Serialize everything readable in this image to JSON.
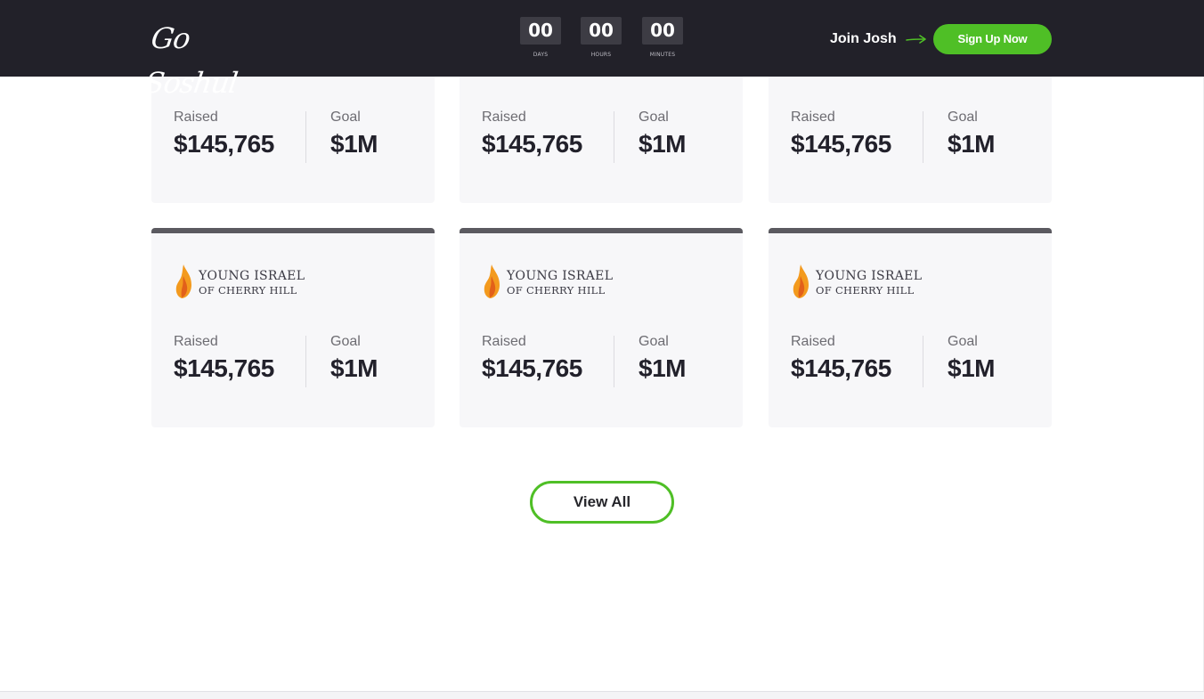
{
  "header": {
    "logo_text": "Go Soshul",
    "countdown": [
      {
        "value": "00",
        "label": "DAYS"
      },
      {
        "value": "00",
        "label": "HOURS"
      },
      {
        "value": "00",
        "label": "MINUTES"
      }
    ],
    "join_text": "Join Josh",
    "signup_label": "Sign Up Now"
  },
  "colors": {
    "header_bg": "#222129",
    "accent_green": "#4fbf26",
    "card_bg": "#f7f7f9",
    "card_bar": "#5b5a60"
  },
  "cards": [
    {
      "org_line1": "",
      "org_line2": "",
      "raised_label": "Raised",
      "raised_value": "$145,765",
      "goal_label": "Goal",
      "goal_value": "$1M"
    },
    {
      "org_line1": "",
      "org_line2": "",
      "raised_label": "Raised",
      "raised_value": "$145,765",
      "goal_label": "Goal",
      "goal_value": "$1M"
    },
    {
      "org_line1": "",
      "org_line2": "",
      "raised_label": "Raised",
      "raised_value": "$145,765",
      "goal_label": "Goal",
      "goal_value": "$1M"
    },
    {
      "org_line1": "YOUNG ISRAEL",
      "org_line2": "OF CHERRY HILL",
      "logo_icon": "flame-icon",
      "raised_label": "Raised",
      "raised_value": "$145,765",
      "goal_label": "Goal",
      "goal_value": "$1M"
    },
    {
      "org_line1": "YOUNG ISRAEL",
      "org_line2": "OF CHERRY HILL",
      "logo_icon": "flame-icon",
      "raised_label": "Raised",
      "raised_value": "$145,765",
      "goal_label": "Goal",
      "goal_value": "$1M"
    },
    {
      "org_line1": "YOUNG ISRAEL",
      "org_line2": "OF CHERRY HILL",
      "logo_icon": "flame-icon",
      "raised_label": "Raised",
      "raised_value": "$145,765",
      "goal_label": "Goal",
      "goal_value": "$1M"
    }
  ],
  "view_all_label": "View All"
}
